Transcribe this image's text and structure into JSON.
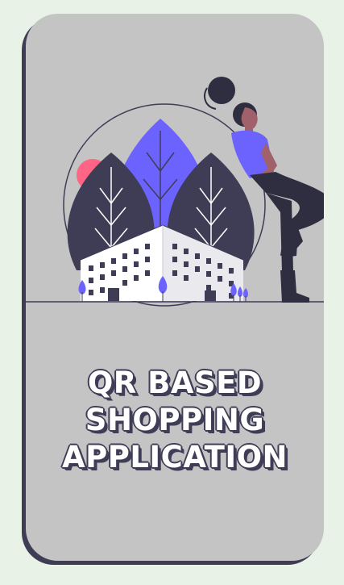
{
  "title_lines": [
    "QR BASED",
    "SHOPPING",
    "APPLICATION"
  ],
  "colors": {
    "background": "#e8f2e6",
    "card": "#c4c4c4",
    "dark": "#3f3d56",
    "accent": "#6c63ff",
    "sun": "#ff6584",
    "building": "#ffffff"
  },
  "illustration": "city-with-woman-illustration"
}
